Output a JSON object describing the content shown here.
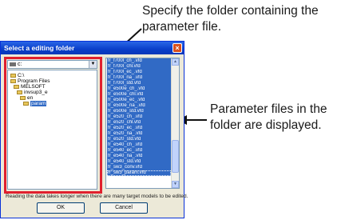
{
  "annotations": {
    "top": "Specify the folder containing the parameter file.",
    "right": "Parameter files in the folder are displayed."
  },
  "dialog": {
    "title": "Select a editing folder",
    "close_glyph": "×",
    "drive_value": "c:",
    "drop_glyph": "▼",
    "tree": [
      "C:\\",
      "Program Files",
      "MELSOFT",
      "invsup3_e",
      "en",
      "param"
    ],
    "selected_folder": "param",
    "files": [
      "fr_f700l_ch_.vfd",
      "fr_f700l_chl.vfd",
      "fr_f700l_ec_.vfd",
      "fr_f700l_na_.vfd",
      "fr_f700l_std.vfd",
      "fr_e500e_ch_.vfd",
      "fr_e500e_chl.vfd",
      "fr_e500e_ec_.vfd",
      "fr_e500e_na_.vfd",
      "fr_e500e_std.vfd",
      "fr_e520_ch_.vfd",
      "fr_e520_chl.vfd",
      "fr_e520_ec_.vfd",
      "fr_e520_na_.vfd",
      "fr_e520_std.vfd",
      "fr_e540_ch_.vfd",
      "fr_e540_ec_.vfd",
      "fr_e540_na_.vfd",
      "fr_e540_std.vfd",
      "fr_sw3_conv.vfd",
      "fr_sw3_param.vfd"
    ],
    "scroll_up_glyph": "▲",
    "scroll_down_glyph": "▼",
    "note": "Reading the data takes longer when there are many target models to be edited.",
    "ok_label": "OK",
    "cancel_label": "Cancel"
  }
}
